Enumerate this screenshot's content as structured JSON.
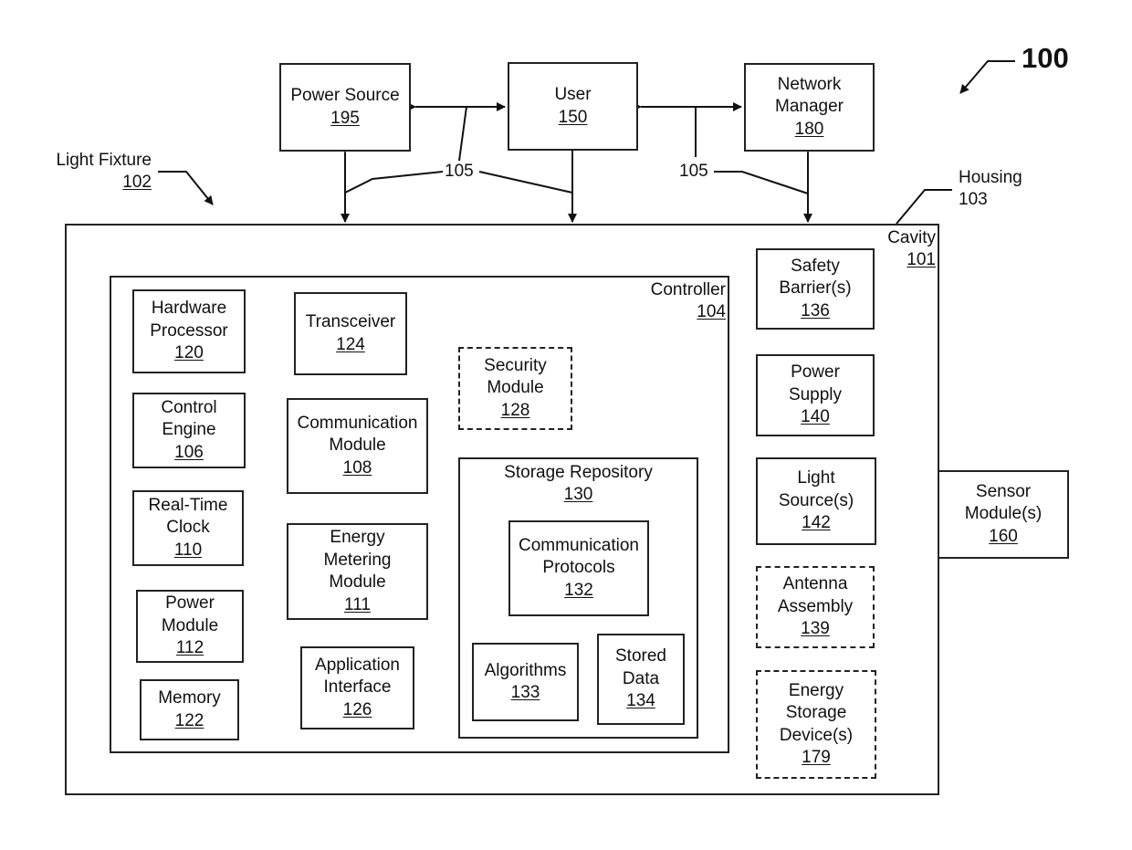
{
  "figure_number": "100",
  "connection_ref": "105",
  "light_fixture": {
    "name": "Light Fixture",
    "num": "102"
  },
  "housing": {
    "name": "Housing",
    "num": "103"
  },
  "cavity": {
    "name": "Cavity",
    "num": "101"
  },
  "controller": {
    "name": "Controller",
    "num": "104"
  },
  "external": {
    "power_source": {
      "lines": [
        "Power Source"
      ],
      "num": "195"
    },
    "user": {
      "lines": [
        "User"
      ],
      "num": "150"
    },
    "network_manager": {
      "lines": [
        "Network",
        "Manager"
      ],
      "num": "180"
    },
    "sensor_module": {
      "lines": [
        "Sensor",
        "Module(s)"
      ],
      "num": "160"
    }
  },
  "controller_components": {
    "hardware_processor": {
      "lines": [
        "Hardware",
        "Processor"
      ],
      "num": "120"
    },
    "control_engine": {
      "lines": [
        "Control",
        "Engine"
      ],
      "num": "106"
    },
    "real_time_clock": {
      "lines": [
        "Real-Time",
        "Clock"
      ],
      "num": "110"
    },
    "power_module": {
      "lines": [
        "Power",
        "Module"
      ],
      "num": "112"
    },
    "memory": {
      "lines": [
        "Memory"
      ],
      "num": "122"
    },
    "transceiver": {
      "lines": [
        "Transceiver"
      ],
      "num": "124"
    },
    "communication_module": {
      "lines": [
        "Communication",
        "Module"
      ],
      "num": "108"
    },
    "energy_metering_module": {
      "lines": [
        "Energy",
        "Metering",
        "Module"
      ],
      "num": "111"
    },
    "application_interface": {
      "lines": [
        "Application",
        "Interface"
      ],
      "num": "126"
    },
    "security_module": {
      "lines": [
        "Security",
        "Module"
      ],
      "num": "128",
      "optional": true
    },
    "storage_repository": {
      "lines": [
        "Storage Repository"
      ],
      "num": "130"
    },
    "communication_protocols": {
      "lines": [
        "Communication",
        "Protocols"
      ],
      "num": "132"
    },
    "algorithms": {
      "lines": [
        "Algorithms"
      ],
      "num": "133"
    },
    "stored_data": {
      "lines": [
        "Stored",
        "Data"
      ],
      "num": "134"
    }
  },
  "housing_components": {
    "safety_barriers": {
      "lines": [
        "Safety",
        "Barrier(s)"
      ],
      "num": "136"
    },
    "power_supply": {
      "lines": [
        "Power",
        "Supply"
      ],
      "num": "140"
    },
    "light_sources": {
      "lines": [
        "Light",
        "Source(s)"
      ],
      "num": "142"
    },
    "antenna_assembly": {
      "lines": [
        "Antenna",
        "Assembly"
      ],
      "num": "139",
      "optional": true
    },
    "energy_storage_devices": {
      "lines": [
        "Energy",
        "Storage",
        "Device(s)"
      ],
      "num": "179",
      "optional": true
    }
  }
}
